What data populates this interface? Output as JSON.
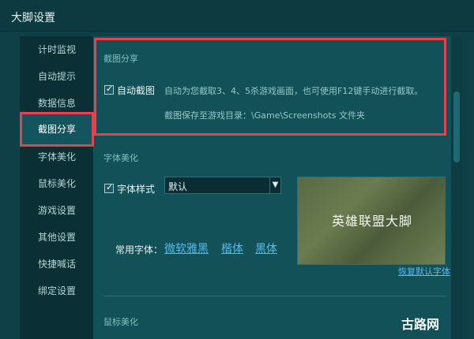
{
  "window": {
    "title": "大脚设置"
  },
  "sidebar": {
    "items": [
      {
        "label": "计时监视"
      },
      {
        "label": "自动提示"
      },
      {
        "label": "数据信息"
      },
      {
        "label": "截图分享",
        "active": true
      },
      {
        "label": "字体美化"
      },
      {
        "label": "鼠标美化"
      },
      {
        "label": "游戏设置"
      },
      {
        "label": "其他设置"
      },
      {
        "label": "快捷喊话"
      },
      {
        "label": "绑定设置"
      }
    ]
  },
  "screenshot_section": {
    "title": "截图分享",
    "auto_checkbox_label": "自动截图",
    "auto_checked": true,
    "hint_line1": "自动为您截取3、4、5杀游戏画面，也可使用F12键手动进行截取。",
    "hint_line2": "截图保存至游戏目录：\\Game\\Screenshots 文件夹"
  },
  "font_section": {
    "title": "字体美化",
    "style_checkbox_label": "字体样式",
    "style_checked": true,
    "style_value": "默认",
    "common_fonts_label": "常用字体：",
    "fonts": [
      "微软雅黑",
      "楷体",
      "黑体"
    ],
    "preview_text": "英雄联盟大脚",
    "restore_link": "恢复默认字体"
  },
  "mouse_section": {
    "title": "鼠标美化"
  },
  "watermark": "古路网",
  "colors": {
    "accent_red": "#e8414b",
    "link_blue": "#58b9ea",
    "background": "#0f4048"
  }
}
